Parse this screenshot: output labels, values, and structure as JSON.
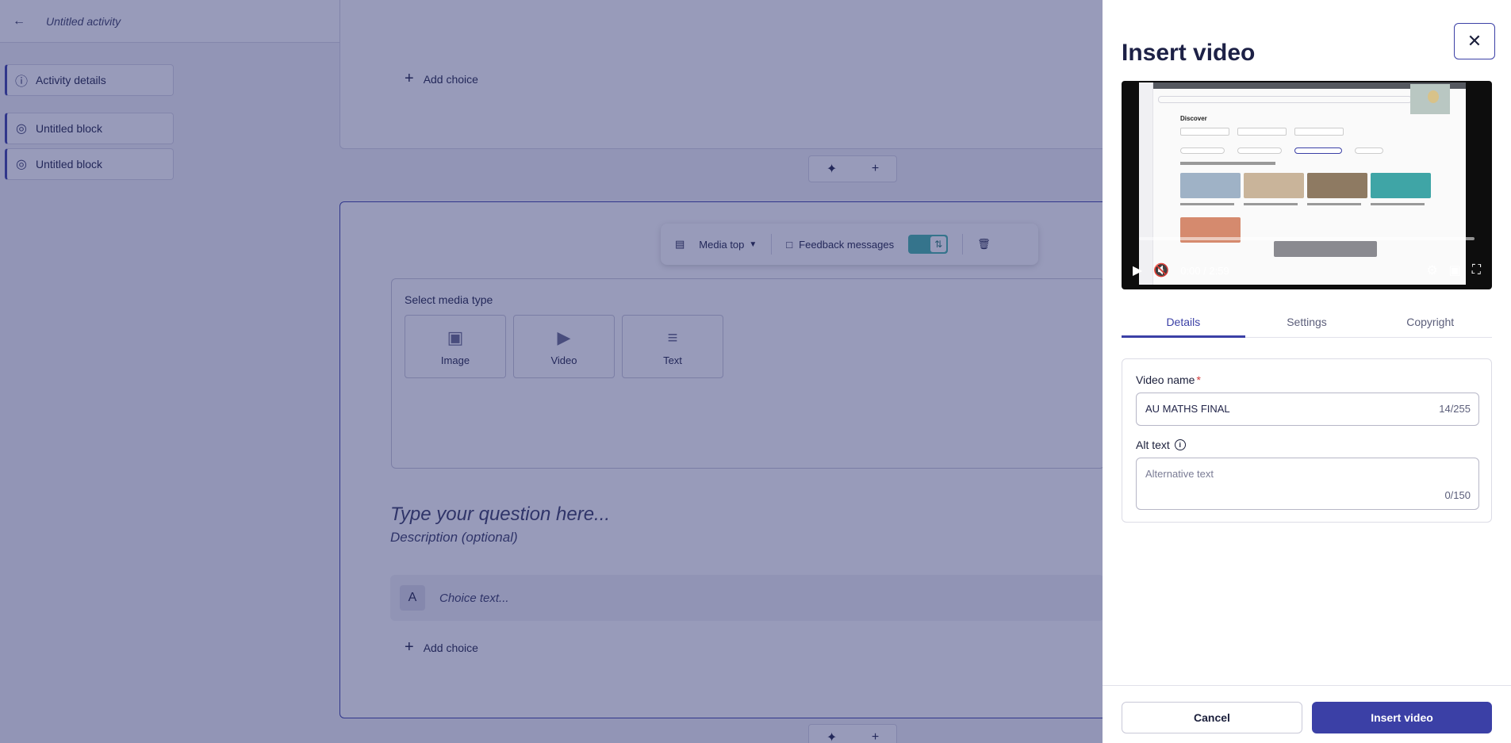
{
  "header": {
    "back_icon": "arrow-left-icon",
    "title": "Untitled activity"
  },
  "sidebar": {
    "items": [
      {
        "label": "Activity details",
        "icon": "info-icon"
      },
      {
        "label": "Untitled block",
        "icon": "block-icon"
      },
      {
        "label": "Untitled block",
        "icon": "block-icon"
      }
    ]
  },
  "editor": {
    "add_choice_label": "Add choice",
    "toolbar": {
      "layout_label": "Media top",
      "feedback_label": "Feedback messages"
    },
    "media": {
      "heading": "Select media type",
      "types": [
        {
          "label": "Image"
        },
        {
          "label": "Video"
        },
        {
          "label": "Text"
        }
      ]
    },
    "question_placeholder": "Type your question here...",
    "description_placeholder": "Description (optional)",
    "choice": {
      "letter": "A",
      "placeholder": "Choice text..."
    }
  },
  "dialog": {
    "title": "Insert video",
    "video": {
      "time": "0:00 / 2:59",
      "screen_heading": "Discover"
    },
    "tabs": [
      {
        "label": "Details",
        "active": true
      },
      {
        "label": "Settings"
      },
      {
        "label": "Copyright"
      }
    ],
    "video_name": {
      "label": "Video name",
      "required_mark": "*",
      "value": "AU MATHS FINAL",
      "counter": "14/255"
    },
    "alt_text": {
      "label": "Alt text",
      "placeholder": "Alternative text",
      "counter": "0/150"
    },
    "cancel_label": "Cancel",
    "insert_label": "Insert video"
  },
  "colors": {
    "accent": "#3b40a6",
    "toggle": "#45b6a9",
    "overlay": "#242b6c"
  }
}
